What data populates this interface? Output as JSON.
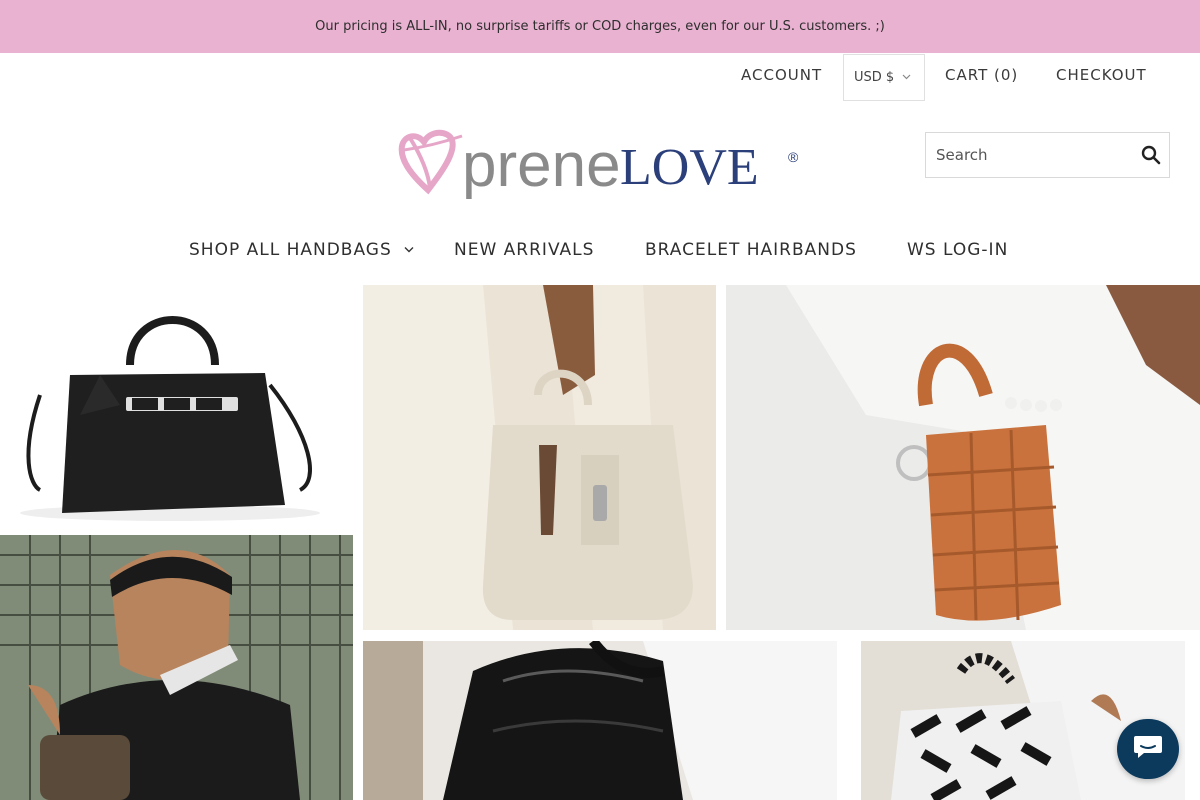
{
  "announcement": "Our pricing is ALL-IN, no surprise tariffs or COD charges, even for our U.S. customers. ;)",
  "topnav": {
    "account": "ACCOUNT",
    "currency": "USD $",
    "cart": "CART (0)",
    "checkout": "CHECKOUT"
  },
  "logo": {
    "part1": "prene",
    "part2": "LOVE",
    "registered": "®"
  },
  "search": {
    "placeholder": "Search"
  },
  "mainnav": {
    "items": [
      {
        "label": "SHOP ALL HANDBAGS"
      },
      {
        "label": "NEW ARRIVALS"
      },
      {
        "label": "BRACELET HAIRBANDS"
      },
      {
        "label": "WS LOG-IN"
      }
    ]
  },
  "colors": {
    "announcement_bg": "#e8b2d0",
    "logo_gray": "#8a8a8a",
    "logo_navy": "#2b3f7a",
    "logo_pink": "#e6a6c8",
    "chat_bg": "#0b3a5d"
  },
  "icons": {
    "search": "search-icon",
    "chat": "chat-icon",
    "dropdown": "chevron-down-icon"
  }
}
